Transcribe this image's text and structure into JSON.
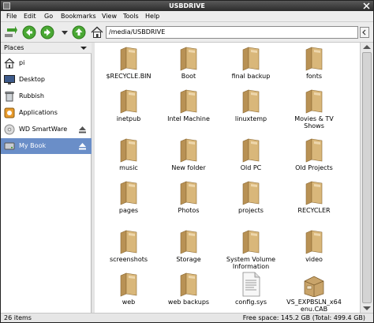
{
  "window": {
    "title": "USBDRIVE"
  },
  "menu": [
    "File",
    "Edit",
    "Go",
    "Bookmarks",
    "View",
    "Tools",
    "Help"
  ],
  "toolbar": {
    "buttons": [
      "new-tab-icon",
      "back-icon",
      "forward-icon",
      "history-dropdown-icon",
      "up-icon",
      "home-icon"
    ],
    "location": "/media/USBDRIVE"
  },
  "sidebar": {
    "header": "Places",
    "places": [
      {
        "label": "pi",
        "icon": "home-icon",
        "eject": false,
        "selected": false
      },
      {
        "label": "Desktop",
        "icon": "desktop-icon",
        "eject": false,
        "selected": false
      },
      {
        "label": "Rubbish",
        "icon": "trash-icon",
        "eject": false,
        "selected": false
      },
      {
        "label": "Applications",
        "icon": "applications-icon",
        "eject": false,
        "selected": false
      },
      {
        "label": "WD SmartWare",
        "icon": "cdrom-icon",
        "eject": true,
        "selected": false
      },
      {
        "label": "My Book",
        "icon": "drive-icon",
        "eject": true,
        "selected": true
      }
    ]
  },
  "files": [
    {
      "name": "$RECYCLE.BIN",
      "type": "folder"
    },
    {
      "name": "Boot",
      "type": "folder"
    },
    {
      "name": "final backup",
      "type": "folder"
    },
    {
      "name": "fonts",
      "type": "folder"
    },
    {
      "name": "inetpub",
      "type": "folder"
    },
    {
      "name": "Intel Machine",
      "type": "folder"
    },
    {
      "name": "linuxtemp",
      "type": "folder"
    },
    {
      "name": "Movies & TV Shows",
      "type": "folder"
    },
    {
      "name": "music",
      "type": "folder"
    },
    {
      "name": "New folder",
      "type": "folder"
    },
    {
      "name": "Old PC",
      "type": "folder"
    },
    {
      "name": "Old Projects",
      "type": "folder"
    },
    {
      "name": "pages",
      "type": "folder"
    },
    {
      "name": "Photos",
      "type": "folder"
    },
    {
      "name": "projects",
      "type": "folder"
    },
    {
      "name": "RECYCLER",
      "type": "folder"
    },
    {
      "name": "screenshots",
      "type": "folder"
    },
    {
      "name": "Storage",
      "type": "folder"
    },
    {
      "name": "System Volume Information",
      "type": "folder"
    },
    {
      "name": "video",
      "type": "folder"
    },
    {
      "name": "web",
      "type": "folder"
    },
    {
      "name": "web backups",
      "type": "folder"
    },
    {
      "name": "config.sys",
      "type": "text-file"
    },
    {
      "name": "VS_EXPBSLN_x64 enu.CAB",
      "type": "archive"
    }
  ],
  "status": {
    "items": "26 items",
    "free_space": "Free space: 145.2 GB (Total: 499.4 GB)"
  },
  "colors": {
    "folder": "#d9b77a",
    "selection": "#6a8ec8",
    "toolbar_green": "#3f9a2a"
  }
}
